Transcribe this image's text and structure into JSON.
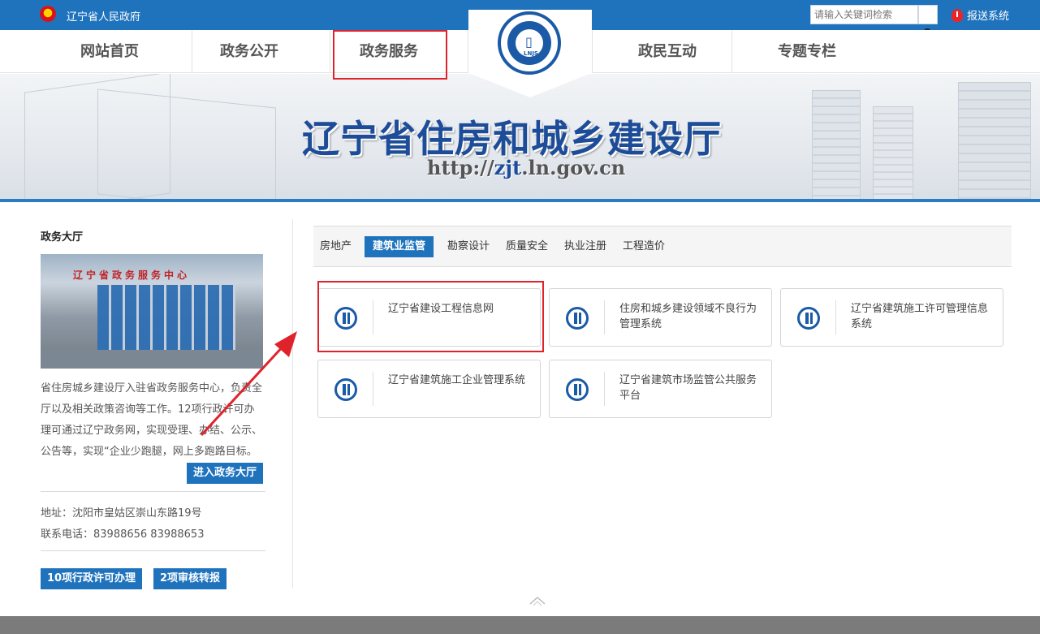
{
  "header": {
    "gov_name": "辽宁省人民政府",
    "search_placeholder": "请输入关键词检索",
    "search_button_glyph": "Q",
    "report_label": "报送系统"
  },
  "nav": {
    "items": [
      "网站首页",
      "政务公开",
      "政务服务",
      "政民互动",
      "专题专栏"
    ],
    "highlighted": "政务服务"
  },
  "logo": {
    "text": "LNJS"
  },
  "banner": {
    "title": "辽宁省住房和城乡建设厅",
    "url_prefix": "http://",
    "url_highlight": "zjt",
    "url_suffix": ".ln.gov.cn"
  },
  "sidebar": {
    "title": "政务大厅",
    "photo_sign": "辽宁省政务服务中心",
    "description": "省住房城乡建设厅入驻省政务服务中心，负责全厅以及相关政策咨询等工作。12项行政许可办理可通过辽宁政务网，实现受理、办结、公示、公告等，实现“企业少跑腿，网上多跑路目标。",
    "enter_button": "进入政务大厅",
    "address": "地址：沈阳市皇姑区崇山东路19号",
    "phone": "联系电话：83988656 83988653",
    "badge1": "10项行政许可办理",
    "badge2": "2项审核转报"
  },
  "tabs": {
    "items": [
      "房地产",
      "建筑业监管",
      "勘察设计",
      "质量安全",
      "执业注册",
      "工程造价"
    ],
    "active": "建筑业监管"
  },
  "cards": [
    "辽宁省建设工程信息网",
    "住房和城乡建设领域不良行为管理系统",
    "辽宁省建筑施工许可管理信息系统",
    "辽宁省建筑施工企业管理系统",
    "辽宁省建筑市场监管公共服务平台"
  ],
  "annotation": {
    "box_color": "#e0232b",
    "arrow_color": "#e0232b"
  },
  "colors": {
    "brand_blue": "#1f73bd",
    "logo_blue": "#1b5aa6"
  }
}
